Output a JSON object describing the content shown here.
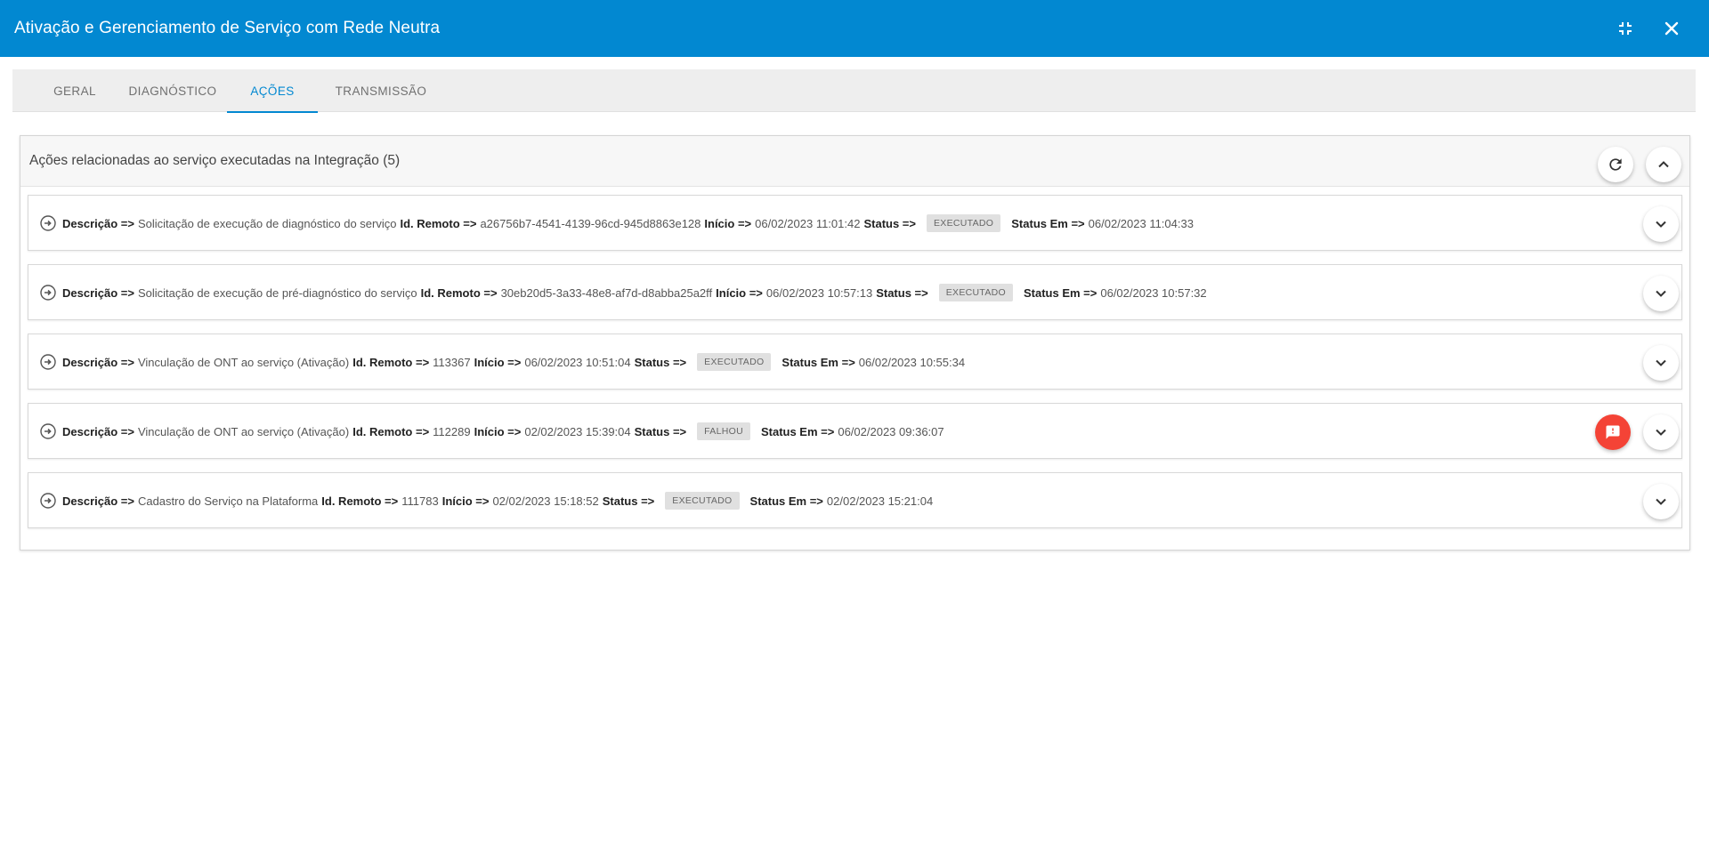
{
  "window": {
    "title": "Ativação e Gerenciamento de Serviço com Rede Neutra"
  },
  "tabs": [
    {
      "label": "GERAL",
      "active": false
    },
    {
      "label": "DIAGNÓSTICO",
      "active": false
    },
    {
      "label": "AÇÕES",
      "active": true
    },
    {
      "label": "TRANSMISSÃO",
      "active": false
    }
  ],
  "colors": {
    "accent": "#0288d1",
    "alert": "#f44336",
    "badge_bg": "#e0e0e0"
  },
  "panel": {
    "title": "Ações relacionadas ao serviço executadas na Integração (5)"
  },
  "labels": {
    "descricao": "Descrição =>",
    "id_remoto": "Id. Remoto =>",
    "inicio": "Início =>",
    "status": "Status =>",
    "status_em": "Status Em =>"
  },
  "actions": [
    {
      "descricao": "Solicitação de execução de diagnóstico do serviço",
      "id_remoto": "a26756b7-4541-4139-96cd-945d8863e128",
      "inicio": "06/02/2023 11:01:42",
      "status": "EXECUTADO",
      "status_em": "06/02/2023 11:04:33",
      "has_alert": false
    },
    {
      "descricao": "Solicitação de execução de pré-diagnóstico do serviço",
      "id_remoto": "30eb20d5-3a33-48e8-af7d-d8abba25a2ff",
      "inicio": "06/02/2023 10:57:13",
      "status": "EXECUTADO",
      "status_em": "06/02/2023 10:57:32",
      "has_alert": false
    },
    {
      "descricao": "Vinculação de ONT ao serviço (Ativação)",
      "id_remoto": "113367",
      "inicio": "06/02/2023 10:51:04",
      "status": "EXECUTADO",
      "status_em": "06/02/2023 10:55:34",
      "has_alert": false
    },
    {
      "descricao": "Vinculação de ONT ao serviço (Ativação)",
      "id_remoto": "112289",
      "inicio": "02/02/2023 15:39:04",
      "status": "FALHOU",
      "status_em": "06/02/2023 09:36:07",
      "has_alert": true
    },
    {
      "descricao": "Cadastro do Serviço na Plataforma",
      "id_remoto": "111783",
      "inicio": "02/02/2023 15:18:52",
      "status": "EXECUTADO",
      "status_em": "02/02/2023 15:21:04",
      "has_alert": false
    }
  ]
}
